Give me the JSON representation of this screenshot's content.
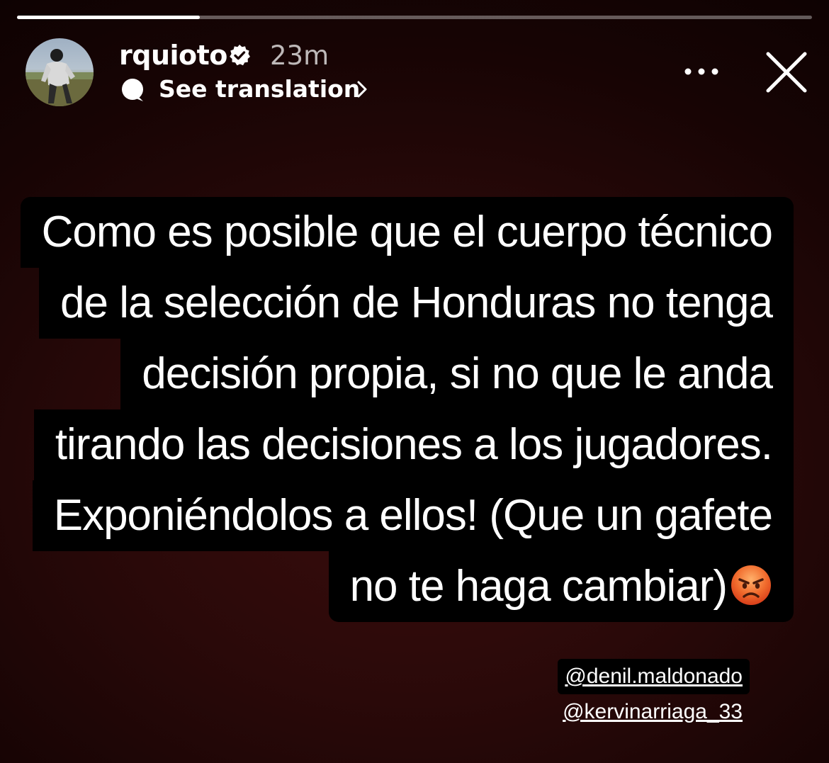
{
  "story": {
    "progress": 0.23
  },
  "header": {
    "username": "rquioto",
    "time": "23m",
    "see_translation": "See translation",
    "avatar_icon": "player-avatar",
    "verified_icon": "verified-badge-icon",
    "more_icon": "more-options-icon",
    "close_icon": "close-icon"
  },
  "caption": {
    "lines": [
      "Como es posible que el cuerpo técnico",
      "de la selección de Honduras no tenga",
      "decisión propia, si no que le anda",
      "tirando las decisiones a los jugadores.",
      "Exponiéndolos a ellos! (Que un gafete",
      "no te haga cambiar)"
    ],
    "emoji": "angry-face"
  },
  "mentions": [
    "@denil.maldonado",
    "@kervinarriaga_33"
  ]
}
